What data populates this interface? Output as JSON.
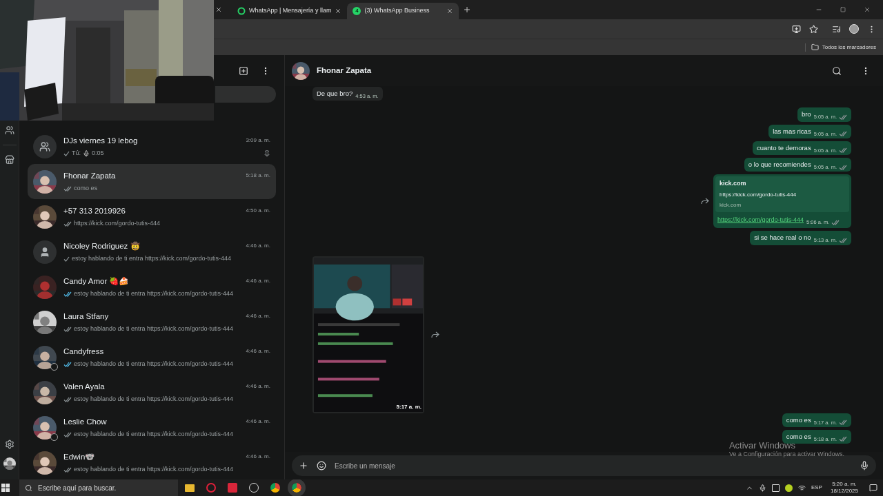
{
  "browser": {
    "tabs": [
      {
        "title": "WhatsApp | Mensajería y llam",
        "selected": false
      },
      {
        "title": "(3) WhatsApp Business",
        "selected": true,
        "badge": "4"
      }
    ],
    "bookmarks": {
      "label": "Todos los marcadores"
    }
  },
  "chat_list": [
    {
      "name": "DJs viernes 19 lebog",
      "avatar": {
        "kind": "group"
      },
      "preview": {
        "kind": "voice",
        "sender": "Tú:",
        "text": "0:05"
      },
      "delivered": false,
      "read": false,
      "time": "3:09 a. m.",
      "pinned": true,
      "selected": false,
      "status_ring": false
    },
    {
      "name": "Fhonar Zapata",
      "preview": {
        "kind": "text",
        "text": "como es"
      },
      "delivered": true,
      "read": false,
      "time": "5:18 a. m.",
      "pinned": false,
      "selected": true,
      "status_ring": false
    },
    {
      "name": "+57 313 2019926",
      "preview": {
        "kind": "text",
        "text": "https://kick.com/gordo-tutis-444"
      },
      "delivered": true,
      "read": false,
      "time": "4:50 a. m.",
      "pinned": false,
      "selected": false,
      "status_ring": false
    },
    {
      "name": "Nicoley Rodriguez 🤠",
      "avatar": {
        "kind": "person"
      },
      "preview": {
        "kind": "text",
        "text": "estoy hablando de ti entra https://kick.com/gordo-tutis-444"
      },
      "delivered": false,
      "read": false,
      "time": "4:46 a. m.",
      "pinned": false,
      "selected": false,
      "status_ring": false
    },
    {
      "name": "Candy Amor 🍓🍰",
      "preview": {
        "kind": "text",
        "text": "estoy hablando de ti entra https://kick.com/gordo-tutis-444"
      },
      "delivered": true,
      "read": true,
      "time": "4:46 a. m.",
      "pinned": false,
      "selected": false,
      "status_ring": false
    },
    {
      "name": "Laura Stfany",
      "preview": {
        "kind": "text",
        "text": "estoy hablando de ti entra https://kick.com/gordo-tutis-444"
      },
      "delivered": true,
      "read": false,
      "time": "4:46 a. m.",
      "pinned": false,
      "selected": false,
      "status_ring": false
    },
    {
      "name": "Candyfress",
      "preview": {
        "kind": "text",
        "text": "estoy hablando de ti entra https://kick.com/gordo-tutis-444"
      },
      "delivered": true,
      "read": true,
      "time": "4:46 a. m.",
      "pinned": false,
      "selected": false,
      "status_ring": true
    },
    {
      "name": "Valen Ayala",
      "preview": {
        "kind": "text",
        "text": "estoy hablando de ti entra https://kick.com/gordo-tutis-444"
      },
      "delivered": true,
      "read": false,
      "time": "4:46 a. m.",
      "pinned": false,
      "selected": false,
      "status_ring": false
    },
    {
      "name": "Leslie Chow",
      "preview": {
        "kind": "text",
        "text": "estoy hablando de ti entra https://kick.com/gordo-tutis-444"
      },
      "delivered": true,
      "read": false,
      "time": "4:46 a. m.",
      "pinned": false,
      "selected": false,
      "status_ring": true
    },
    {
      "name": "Edwin🐨",
      "preview": {
        "kind": "text",
        "text": "estoy hablando de ti entra https://kick.com/gordo-tutis-444"
      },
      "delivered": true,
      "read": false,
      "time": "4:46 a. m.",
      "pinned": false,
      "selected": false,
      "status_ring": false
    }
  ],
  "chat": {
    "name": "Fhonar Zapata",
    "earlier": [
      {
        "kind": "text",
        "outgoing": false,
        "text": "De que bro?",
        "time": "4:53 a. m."
      },
      {
        "kind": "text",
        "outgoing": true,
        "text": "bro",
        "time": "5:05 a. m.",
        "delivered": true,
        "read": false
      },
      {
        "kind": "text",
        "outgoing": true,
        "text": "las mas ricas",
        "time": "5:05 a. m.",
        "delivered": true,
        "read": false
      },
      {
        "kind": "text",
        "outgoing": true,
        "text": "cuanto te demoras",
        "time": "5:05 a. m.",
        "delivered": true,
        "read": false
      },
      {
        "kind": "text",
        "outgoing": true,
        "text": "o lo que recomiendes",
        "time": "5:05 a. m.",
        "delivered": true,
        "read": false
      },
      {
        "kind": "link",
        "outgoing": true,
        "title": "kick.com",
        "url": "https://kick.com/gordo-tutis-444",
        "domain": "kick.com",
        "text": "https://kick.com/gordo-tutis-444",
        "time": "5:06 a. m.",
        "delivered": true,
        "read": false
      },
      {
        "kind": "text",
        "outgoing": true,
        "text": "si se hace real o no",
        "time": "5:13 a. m.",
        "delivered": true,
        "read": false
      },
      {
        "outgoing": false,
        "time": "5:17 a. m."
      }
    ],
    "latest": [
      {
        "kind": "text",
        "outgoing": true,
        "text": "como es",
        "time": "5:17 a. m.",
        "delivered": true,
        "read": false
      },
      {
        "kind": "text",
        "outgoing": true,
        "text": "como es",
        "time": "5:18 a. m.",
        "delivered": true,
        "read": false
      }
    ],
    "composer": {
      "placeholder": "Escribe un mensaje"
    }
  },
  "activation": {
    "title": "Activar Windows",
    "subtitle": "Ve a Configuración para activar Windows."
  },
  "taskbar": {
    "search_placeholder": "Escribe aquí para buscar.",
    "language": "ESP",
    "time": "5:20 a. m.",
    "date": "18/12/2025"
  }
}
